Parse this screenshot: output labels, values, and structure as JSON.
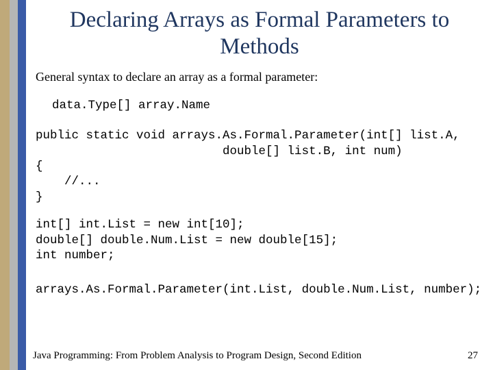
{
  "title": "Declaring Arrays as Formal Parameters to Methods",
  "intro": "General syntax to declare an array as a formal parameter:",
  "syntax_code": "data.Type[] array.Name",
  "method_code": "public static void arrays.As.Formal.Parameter(int[] list.A,\n                          double[] list.B, int num)\n{\n    //...\n}",
  "decl_code": "int[] int.List = new int[10];\ndouble[] double.Num.List = new double[15];\nint number;",
  "call_code": "arrays.As.Formal.Parameter(int.List, double.Num.List, number);",
  "footer": {
    "book": "Java Programming: From Problem Analysis to Program Design, Second Edition",
    "page": "27"
  }
}
